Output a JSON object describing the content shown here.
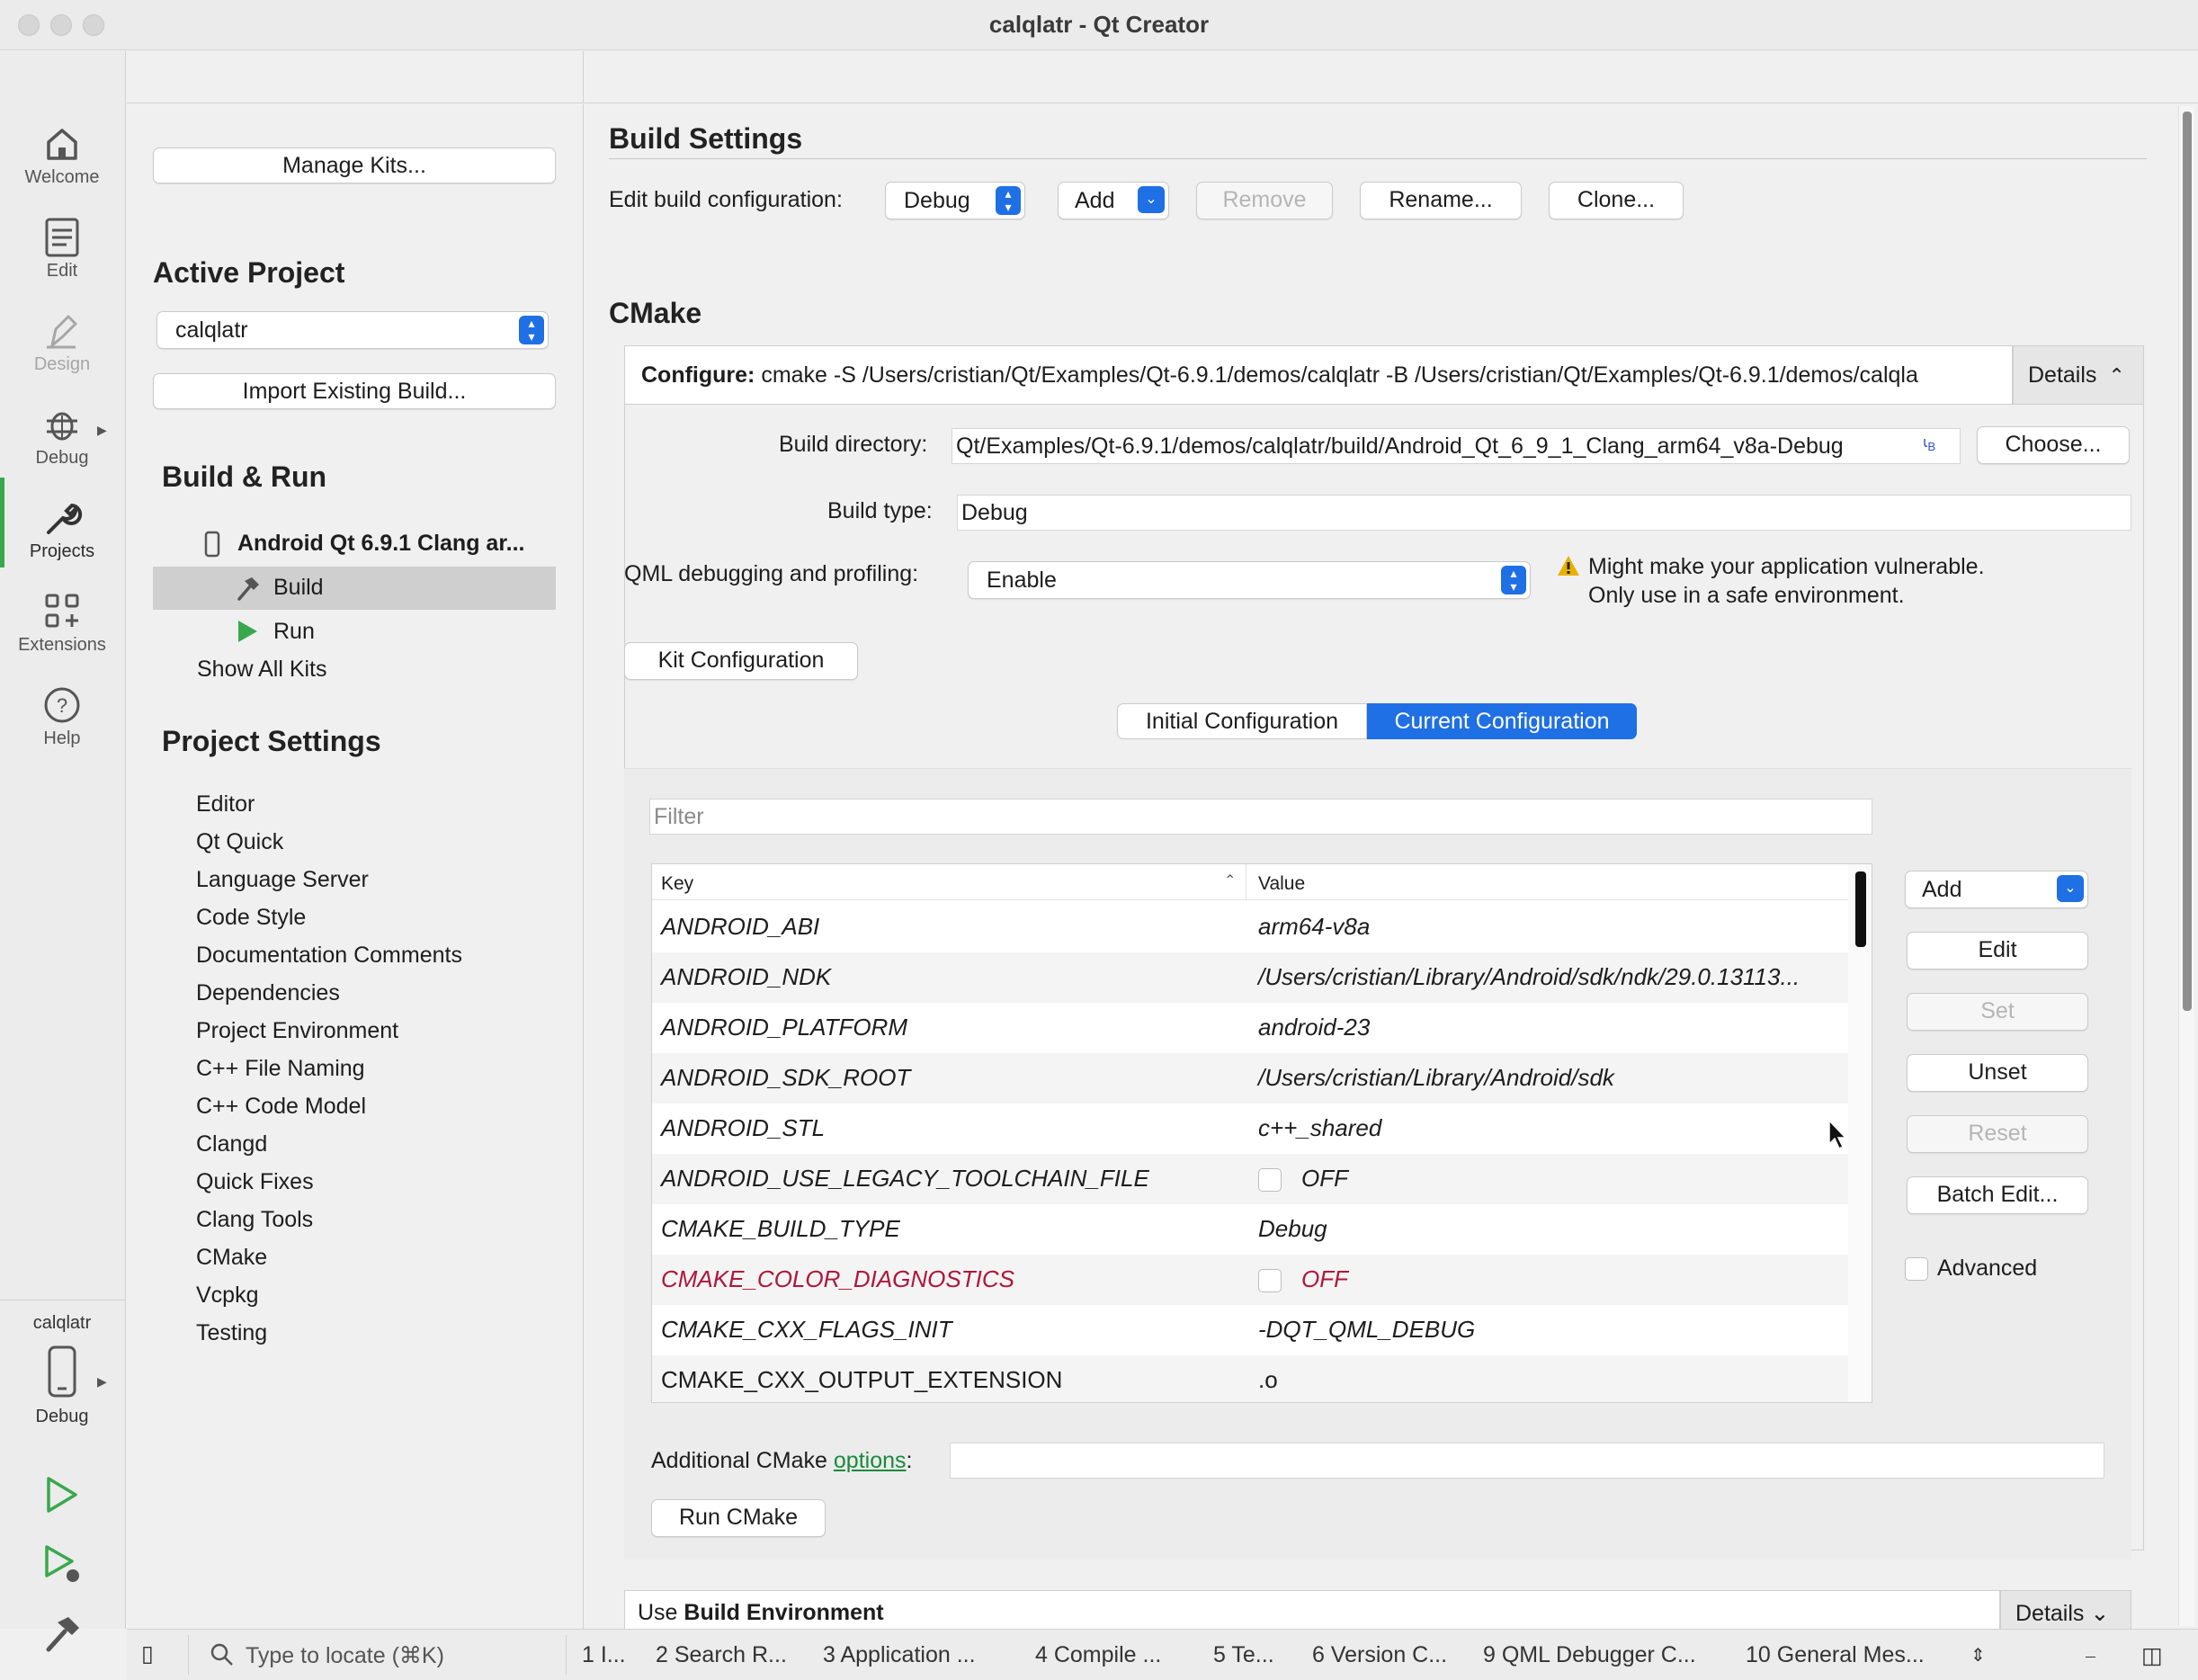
{
  "window": {
    "title": "calqlatr - Qt Creator"
  },
  "modes": [
    {
      "label": "Welcome",
      "icon": "home-icon"
    },
    {
      "label": "Edit",
      "icon": "document-icon"
    },
    {
      "label": "Design",
      "icon": "pen-icon"
    },
    {
      "label": "Debug",
      "icon": "bug-icon"
    },
    {
      "label": "Projects",
      "icon": "wrench-icon"
    },
    {
      "label": "Extensions",
      "icon": "grid-plus-icon"
    },
    {
      "label": "Help",
      "icon": "question-icon"
    }
  ],
  "target_selector": {
    "project": "calqlatr",
    "mode": "Debug"
  },
  "sidebar": {
    "manage_kits": "Manage Kits...",
    "active_project_heading": "Active Project",
    "project_combo": "calqlatr",
    "import_build": "Import Existing Build...",
    "build_run_heading": "Build & Run",
    "kit_name": "Android Qt 6.9.1 Clang ar...",
    "build_label": "Build",
    "run_label": "Run",
    "show_all_kits": "Show All Kits",
    "project_settings_heading": "Project Settings",
    "settings_items": [
      "Editor",
      "Qt Quick",
      "Language Server",
      "Code Style",
      "Documentation Comments",
      "Dependencies",
      "Project Environment",
      "C++ File Naming",
      "C++ Code Model",
      "Clangd",
      "Quick Fixes",
      "Clang Tools",
      "CMake",
      "Vcpkg",
      "Testing"
    ]
  },
  "build_settings": {
    "heading": "Build Settings",
    "edit_config_label": "Edit build configuration:",
    "config_value": "Debug",
    "add": "Add",
    "remove": "Remove",
    "rename": "Rename...",
    "clone": "Clone..."
  },
  "cmake": {
    "heading": "CMake",
    "configure_label": "Configure:",
    "configure_cmd": "cmake -S /Users/cristian/Qt/Examples/Qt-6.9.1/demos/calqlatr -B /Users/cristian/Qt/Examples/Qt-6.9.1/demos/calqla",
    "details": "Details",
    "build_dir_label": "Build directory:",
    "build_dir_value": "Qt/Examples/Qt-6.9.1/demos/calqlatr/build/Android_Qt_6_9_1_Clang_arm64_v8a-Debug",
    "choose": "Choose...",
    "build_type_label": "Build type:",
    "build_type_value": "Debug",
    "qml_debug_label": "QML debugging and profiling:",
    "qml_debug_value": "Enable",
    "warning_line1": "Might make your application vulnerable.",
    "warning_line2": "Only use in a safe environment.",
    "kit_configuration": "Kit Configuration",
    "tab_initial": "Initial Configuration",
    "tab_current": "Current Configuration",
    "filter_placeholder": "Filter",
    "col_key": "Key",
    "col_value": "Value",
    "rows": [
      {
        "key": "ANDROID_ABI",
        "value": "arm64-v8a"
      },
      {
        "key": "ANDROID_NDK",
        "value": "/Users/cristian/Library/Android/sdk/ndk/29.0.13113..."
      },
      {
        "key": "ANDROID_PLATFORM",
        "value": "android-23"
      },
      {
        "key": "ANDROID_SDK_ROOT",
        "value": "/Users/cristian/Library/Android/sdk"
      },
      {
        "key": "ANDROID_STL",
        "value": "c++_shared"
      },
      {
        "key": "ANDROID_USE_LEGACY_TOOLCHAIN_FILE",
        "value": "OFF"
      },
      {
        "key": "CMAKE_BUILD_TYPE",
        "value": "Debug"
      },
      {
        "key": "CMAKE_COLOR_DIAGNOSTICS",
        "value": "OFF"
      },
      {
        "key": "CMAKE_CXX_FLAGS_INIT",
        "value": "-DQT_QML_DEBUG"
      },
      {
        "key": "CMAKE_CXX_OUTPUT_EXTENSION",
        "value": ".o"
      }
    ],
    "side_buttons": {
      "add": "Add",
      "edit": "Edit",
      "set": "Set",
      "unset": "Unset",
      "reset": "Reset",
      "batch_edit": "Batch Edit...",
      "advanced": "Advanced"
    },
    "additional_label": "Additional CMake ",
    "additional_link": "options",
    "additional_colon": ":",
    "run_cmake": "Run CMake",
    "build_env_prefix": "Use ",
    "build_env_bold": "Build Environment",
    "build_env_details": "Details"
  },
  "statusbar": {
    "locate_placeholder": "Type to locate (⌘K)",
    "panes": [
      "1  I...",
      "2  Search R...",
      "3  Application ...",
      "4  Compile ...",
      "5  Te...",
      "6  Version C...",
      "9  QML Debugger C...",
      "10  General Mes..."
    ]
  },
  "colors": {
    "accent": "#1f6fe5",
    "green": "#39a84d",
    "modified_red": "#b0163a",
    "link_green": "#1a8a3a",
    "warning": "#e8b100"
  }
}
